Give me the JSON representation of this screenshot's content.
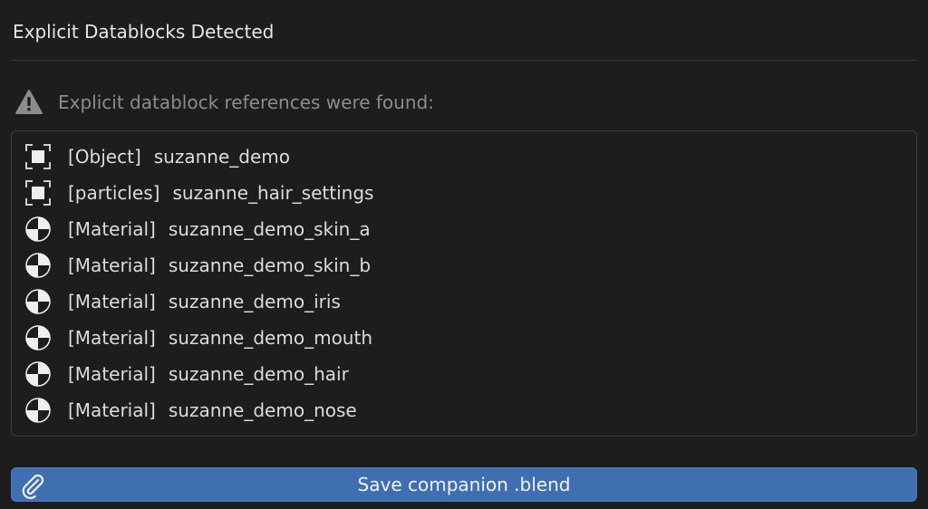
{
  "dialog": {
    "title": "Explicit Datablocks Detected"
  },
  "message": {
    "icon": "warning-icon",
    "text": "Explicit datablock references were found:"
  },
  "items": [
    {
      "type": "[Object]",
      "name": "suzanne_demo",
      "icon": "object-icon"
    },
    {
      "type": "[particles]",
      "name": "suzanne_hair_settings",
      "icon": "object-icon"
    },
    {
      "type": "[Material]",
      "name": "suzanne_demo_skin_a",
      "icon": "material-icon"
    },
    {
      "type": "[Material]",
      "name": "suzanne_demo_skin_b",
      "icon": "material-icon"
    },
    {
      "type": "[Material]",
      "name": "suzanne_demo_iris",
      "icon": "material-icon"
    },
    {
      "type": "[Material]",
      "name": "suzanne_demo_mouth",
      "icon": "material-icon"
    },
    {
      "type": "[Material]",
      "name": "suzanne_demo_hair",
      "icon": "material-icon"
    },
    {
      "type": "[Material]",
      "name": "suzanne_demo_nose",
      "icon": "material-icon"
    }
  ],
  "save_button": {
    "label": "Save companion .blend",
    "icon": "paperclip-icon"
  },
  "colors": {
    "background": "#1d1d1d",
    "button": "#3f6fb0",
    "text": "#dcdcdc",
    "muted_text": "#8c8c8c"
  }
}
